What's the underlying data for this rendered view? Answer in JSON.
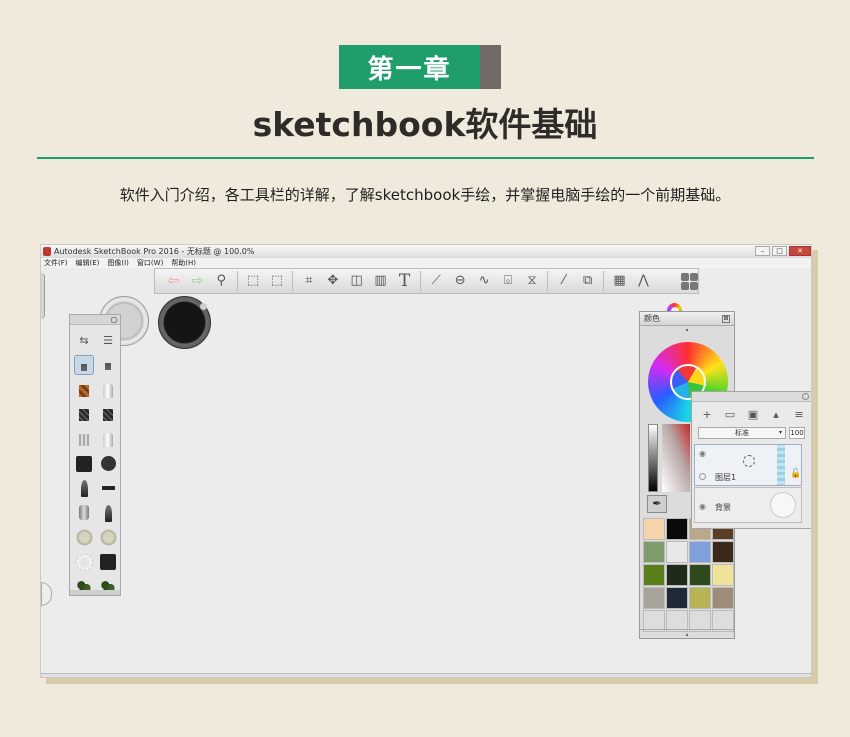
{
  "header": {
    "chapter": "第一章",
    "title": "sketchbook软件基础",
    "subtitle": "软件入门介绍，各工具栏的详解，了解sketchbook手绘，并掌握电脑手绘的一个前期基础。"
  },
  "app": {
    "window_title": "Autodesk SketchBook Pro 2016 - 无标题 @ 100.0%",
    "win_minimize": "–",
    "win_maximize": "□",
    "win_close": "✕",
    "menu": [
      "文件(F)",
      "编辑(E)",
      "图像(I)",
      "窗口(W)",
      "帮助(H)"
    ]
  },
  "toolbar": {
    "icons": {
      "undo": "⇦",
      "redo": "⇨",
      "zoom": "⚲",
      "select": "⬚",
      "lasso": "⬚",
      "crop": "⌗",
      "move": "✥",
      "distort": "◫",
      "fill": "▥",
      "text": "T",
      "ruler": "⟋",
      "ellipse": "⊖",
      "curve": "∿",
      "perspective": "⌺",
      "symmetry": "⧖",
      "stroke": "⁄",
      "copy": "⧉",
      "brush_library": "▦",
      "brushes": "⋀"
    }
  },
  "brush_panel": {
    "icons": {
      "swap": "⇆",
      "palette": "☰"
    }
  },
  "color_panel": {
    "title": "颜色",
    "close": "⊠",
    "up": "▾",
    "down": "▴",
    "eyedropper": "✒",
    "swatches": [
      "#f3d4ab",
      "#0b0b0b",
      "#b9a98a",
      "#5a3d25",
      "#7f9b6b",
      "#e8e8e8",
      "#7fa0d8",
      "#3b2a1a",
      "#5c7f1e",
      "#1f2a18",
      "#2e4a1a",
      "#efe39a",
      "#a8a39b",
      "#1f2a38",
      "#b8b456",
      "#9c8e76",
      "#dddddd",
      "#dddddd",
      "#dddddd",
      "#dddddd"
    ]
  },
  "layer_panel": {
    "tools": {
      "add": "+",
      "folder": "▭",
      "image": "▣",
      "lock": "▴",
      "menu": "≡"
    },
    "blend_mode": "标准",
    "blend_arrow": "▾",
    "opacity": "100",
    "layers": [
      {
        "name": "图层1",
        "eye": "◉",
        "lock": "🔓"
      },
      {
        "name": "背景",
        "eye": "◉"
      }
    ]
  }
}
